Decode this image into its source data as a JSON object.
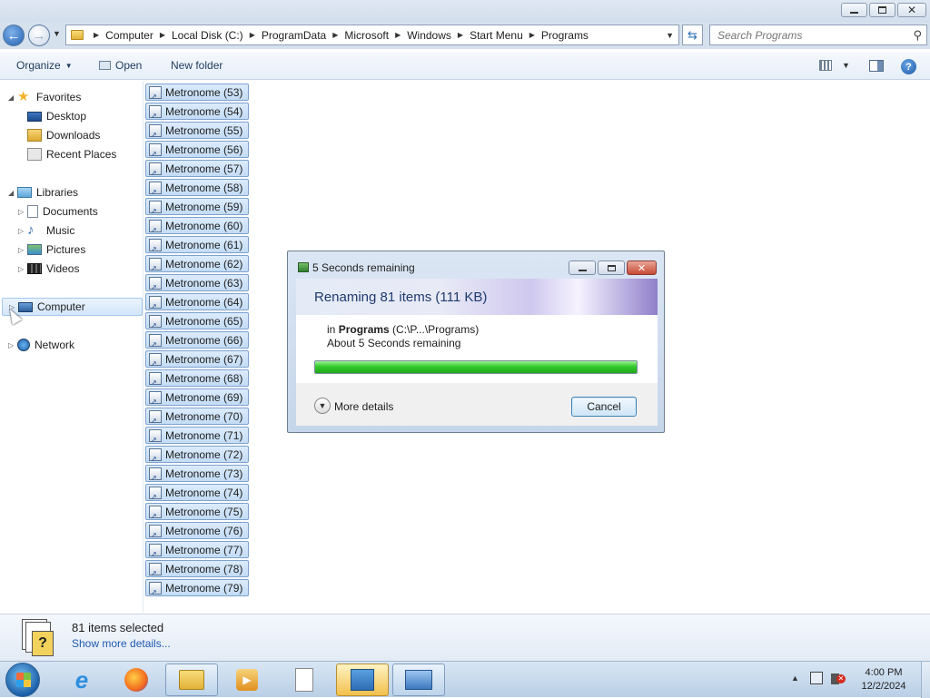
{
  "window": {
    "caption_buttons": {
      "minimize": "minimize",
      "maximize": "restore",
      "close": "close"
    }
  },
  "address_bar": {
    "breadcrumbs": [
      "Computer",
      "Local Disk (C:)",
      "ProgramData",
      "Microsoft",
      "Windows",
      "Start Menu",
      "Programs"
    ]
  },
  "search": {
    "placeholder": "Search Programs"
  },
  "toolbar": {
    "organize_label": "Organize",
    "open_label": "Open",
    "new_folder_label": "New folder"
  },
  "nav": {
    "favorites": "Favorites",
    "desktop": "Desktop",
    "downloads": "Downloads",
    "recent_places": "Recent Places",
    "libraries": "Libraries",
    "documents": "Documents",
    "music": "Music",
    "pictures": "Pictures",
    "videos": "Videos",
    "computer": "Computer",
    "network": "Network"
  },
  "files": [
    "Metronome (53)",
    "Metronome (54)",
    "Metronome (55)",
    "Metronome (56)",
    "Metronome (57)",
    "Metronome (58)",
    "Metronome (59)",
    "Metronome (60)",
    "Metronome (61)",
    "Metronome (62)",
    "Metronome (63)",
    "Metronome (64)",
    "Metronome (65)",
    "Metronome (66)",
    "Metronome (67)",
    "Metronome (68)",
    "Metronome (69)",
    "Metronome (70)",
    "Metronome (71)",
    "Metronome (72)",
    "Metronome (73)",
    "Metronome (74)",
    "Metronome (75)",
    "Metronome (76)",
    "Metronome (77)",
    "Metronome (78)",
    "Metronome (79)"
  ],
  "details": {
    "selection": "81 items selected",
    "more_link": "Show more details..."
  },
  "dialog": {
    "title": "5 Seconds remaining",
    "heading": "Renaming 81 items (111 KB)",
    "in_prefix": "in ",
    "destination": "Programs",
    "destination_path": " (C:\\P...\\Programs)",
    "time_remaining": "About 5 Seconds remaining",
    "progress_percent": 100,
    "more_details": "More details",
    "cancel": "Cancel"
  },
  "taskbar": {
    "clock_time": "4:00 PM",
    "clock_date": "12/2/2024",
    "items": [
      "start-button",
      "internet-explorer",
      "firefox",
      "windows-explorer",
      "media-player",
      "notepad",
      "app",
      "desktop-app"
    ]
  },
  "colors": {
    "progress_fill": "#33c92d",
    "accent": "#1f5ab0"
  }
}
